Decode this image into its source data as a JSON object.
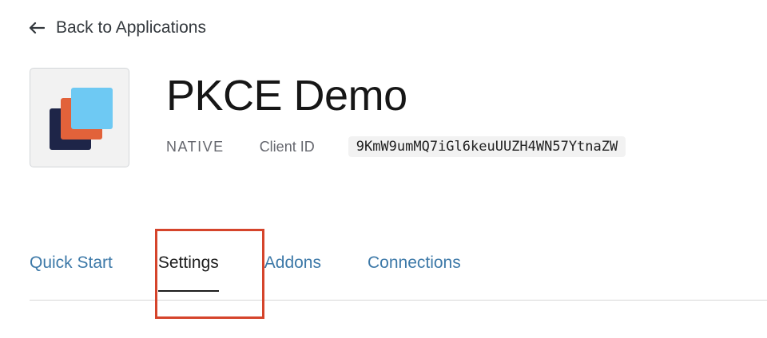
{
  "back_link": {
    "icon": "arrow-left-icon",
    "label": "Back to Applications"
  },
  "app": {
    "name": "PKCE Demo",
    "type": "NATIVE",
    "client_id_label": "Client ID",
    "client_id": "9KmW9umMQ7iGl6keuUUZH4WN57YtnaZW",
    "logo_colors": {
      "back": "#1e2548",
      "middle": "#e2623a",
      "front": "#6ec9f3"
    }
  },
  "tabs": [
    {
      "label": "Quick Start",
      "active": false
    },
    {
      "label": "Settings",
      "active": true
    },
    {
      "label": "Addons",
      "active": false
    },
    {
      "label": "Connections",
      "active": false
    }
  ],
  "colors": {
    "link": "#3d79a8",
    "highlight": "#d5442b"
  }
}
